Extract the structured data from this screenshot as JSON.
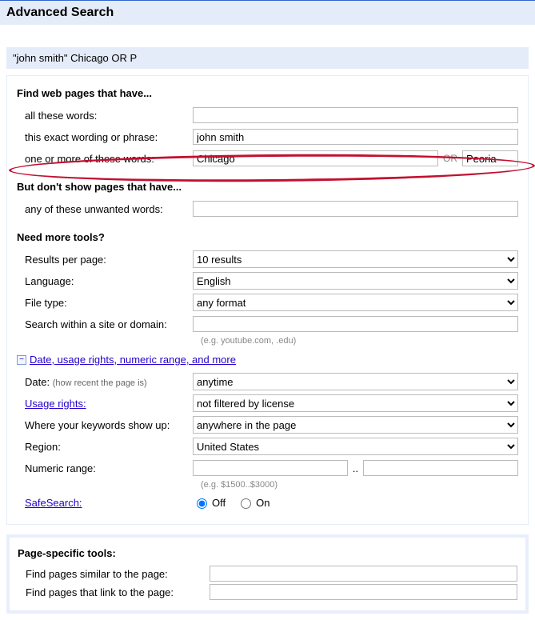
{
  "header": {
    "title": "Advanced Search"
  },
  "query_preview": "\"john smith\" Chicago OR P",
  "find": {
    "heading": "Find web pages that have...",
    "all_words": {
      "label": "all these words:",
      "value": ""
    },
    "exact_phrase": {
      "label": "this exact wording or phrase:",
      "value": "john smith"
    },
    "one_or_more": {
      "label": "one or more of these words:",
      "value1": "Chicago",
      "or": "OR",
      "value2": "Peoria"
    }
  },
  "exclude": {
    "heading": "But don't show pages that have...",
    "unwanted": {
      "label": "any of these unwanted words:",
      "value": ""
    }
  },
  "tools": {
    "heading": "Need more tools?",
    "results_per_page": {
      "label": "Results per page:",
      "value": "10 results"
    },
    "language": {
      "label": "Language:",
      "value": "English"
    },
    "file_type": {
      "label": "File type:",
      "value": "any format"
    },
    "site": {
      "label": "Search within a site or domain:",
      "value": "",
      "hint": "(e.g. youtube.com, .edu)"
    }
  },
  "more": {
    "toggle": "Date, usage rights, numeric range, and more",
    "date": {
      "label": "Date:",
      "note": "(how recent the page is)",
      "value": "anytime"
    },
    "usage_rights": {
      "label": "Usage rights:",
      "value": "not filtered by license"
    },
    "where": {
      "label": "Where your keywords show up:",
      "value": "anywhere in the page"
    },
    "region": {
      "label": "Region:",
      "value": "United States"
    },
    "numeric": {
      "label": "Numeric range:",
      "from": "",
      "to": "",
      "sep": "..",
      "hint": "(e.g. $1500..$3000)"
    },
    "safesearch": {
      "label": "SafeSearch:",
      "off": "Off",
      "on": "On",
      "selected": "off"
    }
  },
  "page_specific": {
    "heading": "Page-specific tools:",
    "similar": {
      "label": "Find pages similar to the page:",
      "value": ""
    },
    "link_to": {
      "label": "Find pages that link to the page:",
      "value": ""
    }
  }
}
